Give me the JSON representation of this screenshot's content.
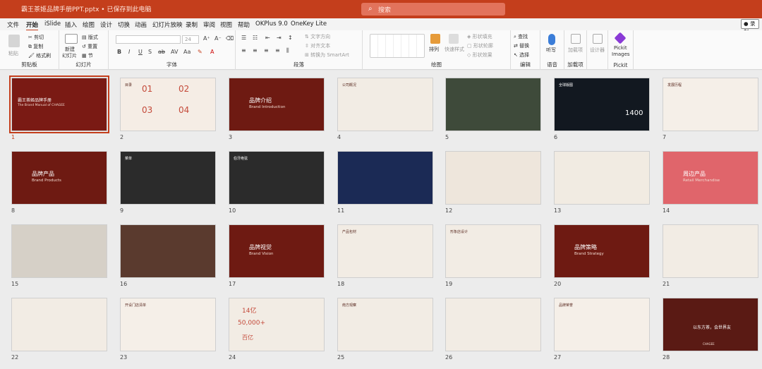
{
  "titlebar": {
    "doc_title": "霸王茶姬品牌手册PPT.pptx • 已保存到此电脑",
    "search_placeholder": "搜索"
  },
  "tabs": [
    "文件",
    "开始",
    "iSlide",
    "插入",
    "绘图",
    "设计",
    "切换",
    "动画",
    "幻灯片放映",
    "录制",
    "审阅",
    "视图",
    "帮助",
    "OKPlus 9.0",
    "OneKey Lite"
  ],
  "active_tab": "开始",
  "record_label": "录制",
  "ribbon": {
    "clipboard": {
      "label": "剪贴板",
      "paste": "粘贴",
      "cut": "剪切",
      "copy": "复制",
      "format_painter": "格式刷"
    },
    "slides": {
      "label": "幻灯片",
      "new_slide": "新建",
      "new_slide2": "幻灯片",
      "layout": "版式",
      "reset": "重置",
      "section": "节"
    },
    "font": {
      "label": "字体",
      "size": "24"
    },
    "paragraph": {
      "label": "段落",
      "text_direction": "文字方向",
      "align_text": "对齐文本",
      "smartart": "转换为 SmartArt"
    },
    "drawing": {
      "label": "绘图",
      "arrange": "排列",
      "quick_styles": "快速样式",
      "shape_fill": "形状填充",
      "shape_outline": "形状轮廓",
      "shape_effects": "形状效果"
    },
    "editing": {
      "label": "编辑",
      "find": "查找",
      "replace": "替换",
      "select": "选择"
    },
    "voice": {
      "label": "语音",
      "dictate": "听写"
    },
    "addins": {
      "label": "加载项",
      "addins_btn": "加载项"
    },
    "designer": {
      "label": "",
      "designer_btn": "设计器"
    },
    "pickit": {
      "label": "Pickit",
      "btn1": "Pickit",
      "btn2": "Images"
    }
  },
  "slides": [
    {
      "n": "1",
      "bg": "#7a1a14",
      "title": "霸王茶姬品牌手册",
      "sub": "The Brand Manual of CHAGEE",
      "selected": true
    },
    {
      "n": "2",
      "bg": "#f5ede5",
      "title": "目录",
      "nums": [
        "01",
        "02",
        "03",
        "04"
      ]
    },
    {
      "n": "3",
      "bg": "#6e1a12",
      "title": "品牌介绍",
      "sub": "Brand Introduction"
    },
    {
      "n": "4",
      "bg": "#f2ece4",
      "title": "公司概况"
    },
    {
      "n": "5",
      "bg": "#3e4a3a",
      "title": ""
    },
    {
      "n": "6",
      "bg": "#121820",
      "title": "全球版图",
      "big": "1400"
    },
    {
      "n": "7",
      "bg": "#f5efe8",
      "title": "发展历程"
    },
    {
      "n": "8",
      "bg": "#6e1a12",
      "title": "品牌产品",
      "sub": "Brand Products"
    },
    {
      "n": "9",
      "bg": "#2b2b2b",
      "title": "菜单"
    },
    {
      "n": "10",
      "bg": "#2b2b2b",
      "title": "伯牙绝弦"
    },
    {
      "n": "11",
      "bg": "#1b2a55",
      "title": ""
    },
    {
      "n": "12",
      "bg": "#eee6dc",
      "title": ""
    },
    {
      "n": "13",
      "bg": "#f1ebe2",
      "title": ""
    },
    {
      "n": "14",
      "bg": "#e0656b",
      "title": "周边产品",
      "sub": "Retail Merchandise"
    },
    {
      "n": "15",
      "bg": "#d6d0c7",
      "title": ""
    },
    {
      "n": "16",
      "bg": "#5a3a2e",
      "title": ""
    },
    {
      "n": "17",
      "bg": "#6e1a12",
      "title": "品牌视觉",
      "sub": "Brand Vision"
    },
    {
      "n": "18",
      "bg": "#f2ece4",
      "title": "产品包材"
    },
    {
      "n": "19",
      "bg": "#f2ece4",
      "title": "形象店设计"
    },
    {
      "n": "20",
      "bg": "#6e1a12",
      "title": "品牌策略",
      "sub": "Brand Strategy"
    },
    {
      "n": "21",
      "bg": "#f2ece4",
      "title": ""
    },
    {
      "n": "22",
      "bg": "#f2ece4",
      "title": ""
    },
    {
      "n": "23",
      "bg": "#f5efe8",
      "title": "开设门店清单"
    },
    {
      "n": "24",
      "bg": "#f2ece4",
      "title": "",
      "big": "14亿",
      "big2": "50,000+",
      "big3": "百亿"
    },
    {
      "n": "25",
      "bg": "#f2ece4",
      "title": "南方观察"
    },
    {
      "n": "26",
      "bg": "#f2ece4",
      "title": ""
    },
    {
      "n": "27",
      "bg": "#f5efe8",
      "title": "品牌荣誉"
    },
    {
      "n": "28",
      "bg": "#5a1a14",
      "title": "以东方茶，会世界友",
      "sub": "CHAGEE"
    }
  ]
}
